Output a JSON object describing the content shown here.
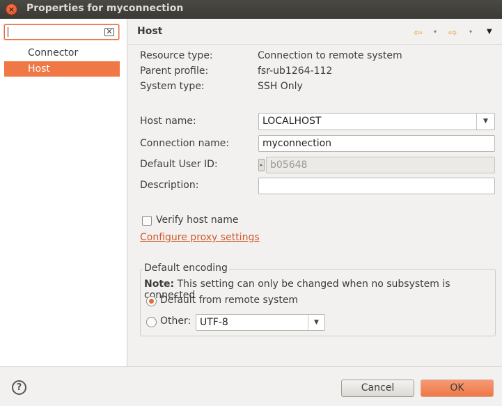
{
  "window": {
    "title": "Properties for myconnection",
    "close_glyph": "×"
  },
  "filter": {
    "value": "",
    "clear_glyph": "⌫"
  },
  "tree": {
    "items": [
      {
        "label": "Connector Services"
      },
      {
        "label": "Host",
        "selected": true
      }
    ]
  },
  "page": {
    "title": "Host",
    "nav": {
      "back_glyph": "⇦",
      "forward_glyph": "⇨",
      "dropdown_glyph": "▾",
      "menu_glyph": "▼"
    }
  },
  "info": {
    "resource_type_label": "Resource type:",
    "resource_type_value": "Connection to remote system",
    "parent_profile_label": "Parent profile:",
    "parent_profile_value": "fsr-ub1264-112",
    "system_type_label": "System type:",
    "system_type_value": "SSH Only"
  },
  "form": {
    "host_name_label": "Host name:",
    "host_name_value": "LOCALHOST",
    "connection_name_label": "Connection name:",
    "connection_name_value": "myconnection",
    "default_user_id_label": "Default User ID:",
    "default_user_id_value": "b05648",
    "description_label": "Description:",
    "description_value": "",
    "verify_host_label": "Verify host name",
    "verify_host_checked": false,
    "proxy_link": "Configure proxy settings"
  },
  "encoding": {
    "group_title": "Default encoding",
    "note_bold": "Note:",
    "note_text": " This setting can only be changed when no subsystem is connected",
    "default_option": "Default from remote system",
    "other_option": "Other:",
    "other_value": "UTF-8",
    "selected": "default"
  },
  "buttons": {
    "help_glyph": "?",
    "cancel": "Cancel",
    "ok": "OK"
  },
  "colors": {
    "accent": "#f07746",
    "link": "#d4572a",
    "titlebar": "#3b3a36"
  }
}
